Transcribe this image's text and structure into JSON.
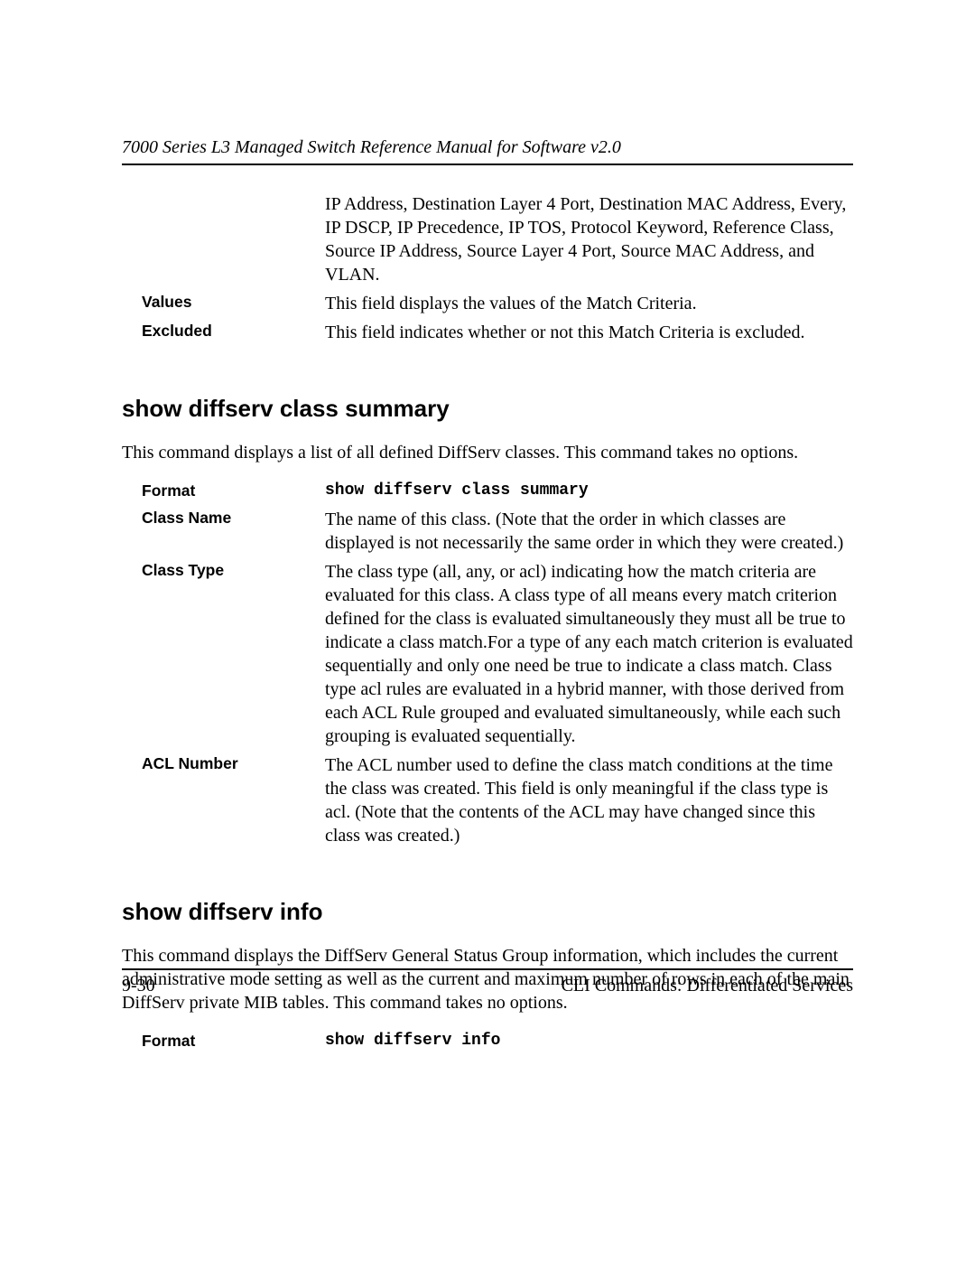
{
  "header": {
    "running_head": "7000 Series L3 Managed Switch Reference Manual for Software v2.0"
  },
  "top_defs": {
    "continuation": "IP Address, Destination Layer 4 Port, Destination MAC Address, Every, IP DSCP, IP Precedence, IP TOS, Protocol Keyword, Reference Class, Source IP Address, Source Layer 4 Port, Source MAC Address, and VLAN.",
    "values_label": "Values",
    "values_desc": "This field displays the values of the Match Criteria.",
    "excluded_label": "Excluded",
    "excluded_desc": "This field indicates whether or not this Match Criteria is excluded."
  },
  "section1": {
    "heading": "show diffserv class summary",
    "intro": "This command displays a list of all defined DiffServ classes. This command takes no options.",
    "format_label": "Format",
    "format_value": "show diffserv class summary",
    "classname_label": "Class Name",
    "classname_desc": "The name of this class. (Note that the order in which classes are displayed is not necessarily the same order in which they were created.)",
    "classtype_label": "Class Type",
    "classtype_desc": "The class type (all, any, or acl) indicating how the match criteria are evaluated for this class. A class type of all means every match criterion defined for the class is evaluated simultaneously they must all be true to indicate a class match.For a type of any each match criterion is evaluated sequentially and only one need be true to indicate a class match. Class type acl rules are evaluated in a hybrid manner, with those derived from each ACL Rule grouped and evaluated simultaneously, while each such grouping is evaluated sequentially.",
    "acl_label": "ACL Number",
    "acl_desc": "The ACL number used to define the class match conditions at the time the class was created. This field is only meaningful if the class type is acl. (Note that the contents of the ACL may have changed since this class was created.)"
  },
  "section2": {
    "heading": "show diffserv info",
    "intro": "This command displays the DiffServ General Status Group information, which includes the current administrative mode setting as well as the current and maximum number of rows in each of the main DiffServ private MIB tables. This command takes no options.",
    "format_label": "Format",
    "format_value": "show diffserv info"
  },
  "footer": {
    "page_number": "9-30",
    "chapter": "CLI Commands: Differentiated Services"
  }
}
